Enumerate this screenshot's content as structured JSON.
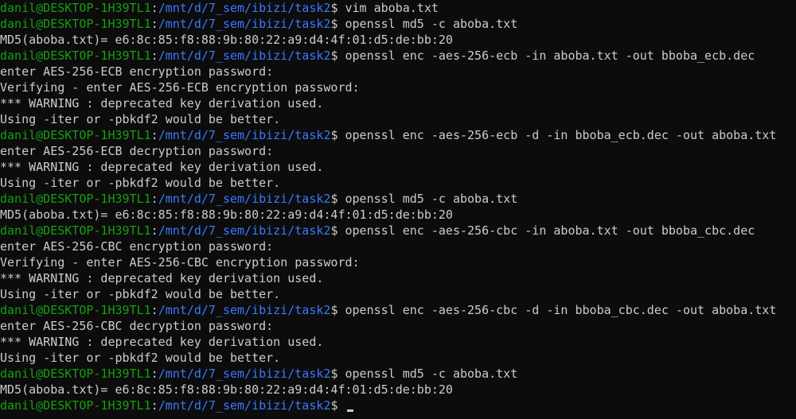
{
  "prompt": {
    "user_host": "danil@DESKTOP-1H39TL1",
    "path": "/mnt/d/7_sem/ibizi/task2",
    "symbol": "$"
  },
  "lines": [
    {
      "type": "prompt",
      "command": "vim aboba.txt"
    },
    {
      "type": "prompt",
      "command": "openssl md5 -c aboba.txt"
    },
    {
      "type": "output",
      "text": "MD5(aboba.txt)= e6:8c:85:f8:88:9b:80:22:a9:d4:4f:01:d5:de:bb:20"
    },
    {
      "type": "prompt",
      "command": "openssl enc -aes-256-ecb -in aboba.txt -out bboba_ecb.dec"
    },
    {
      "type": "output",
      "text": "enter AES-256-ECB encryption password:"
    },
    {
      "type": "output",
      "text": "Verifying - enter AES-256-ECB encryption password:"
    },
    {
      "type": "output",
      "text": "*** WARNING : deprecated key derivation used."
    },
    {
      "type": "output",
      "text": "Using -iter or -pbkdf2 would be better."
    },
    {
      "type": "prompt",
      "command": "openssl enc -aes-256-ecb -d -in bboba_ecb.dec -out aboba.txt"
    },
    {
      "type": "output",
      "text": "enter AES-256-ECB decryption password:"
    },
    {
      "type": "output",
      "text": "*** WARNING : deprecated key derivation used."
    },
    {
      "type": "output",
      "text": "Using -iter or -pbkdf2 would be better."
    },
    {
      "type": "prompt",
      "command": "openssl md5 -c aboba.txt"
    },
    {
      "type": "output",
      "text": "MD5(aboba.txt)= e6:8c:85:f8:88:9b:80:22:a9:d4:4f:01:d5:de:bb:20"
    },
    {
      "type": "prompt",
      "command": "openssl enc -aes-256-cbc -in aboba.txt -out bboba_cbc.dec"
    },
    {
      "type": "output",
      "text": "enter AES-256-CBC encryption password:"
    },
    {
      "type": "output",
      "text": "Verifying - enter AES-256-CBC encryption password:"
    },
    {
      "type": "output",
      "text": "*** WARNING : deprecated key derivation used."
    },
    {
      "type": "output",
      "text": "Using -iter or -pbkdf2 would be better."
    },
    {
      "type": "prompt",
      "command": "openssl enc -aes-256-cbc -d -in bboba_cbc.dec -out aboba.txt"
    },
    {
      "type": "output",
      "text": "enter AES-256-CBC decryption password:"
    },
    {
      "type": "output",
      "text": "*** WARNING : deprecated key derivation used."
    },
    {
      "type": "output",
      "text": "Using -iter or -pbkdf2 would be better."
    },
    {
      "type": "prompt",
      "command": "openssl md5 -c aboba.txt"
    },
    {
      "type": "output",
      "text": "MD5(aboba.txt)= e6:8c:85:f8:88:9b:80:22:a9:d4:4f:01:d5:de:bb:20"
    },
    {
      "type": "prompt",
      "command": "",
      "cursor": true
    }
  ],
  "colors": {
    "background": "#0c0c0c",
    "foreground": "#cccccc",
    "user_host": "#13a10e",
    "path": "#3b78ff"
  }
}
